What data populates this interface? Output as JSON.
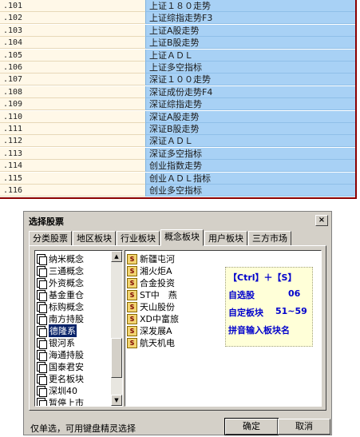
{
  "commands": [
    {
      "code": ".101",
      "desc": "上证１８０走势"
    },
    {
      "code": ".102",
      "desc": "上证综指走势F3"
    },
    {
      "code": ".103",
      "desc": "上证A股走势"
    },
    {
      "code": ".104",
      "desc": "上证B股走势"
    },
    {
      "code": ".105",
      "desc": "上证ＡＤＬ"
    },
    {
      "code": ".106",
      "desc": "上证多空指标"
    },
    {
      "code": ".107",
      "desc": "深证１００走势"
    },
    {
      "code": ".108",
      "desc": "深证成份走势F4"
    },
    {
      "code": ".109",
      "desc": "深证综指走势"
    },
    {
      "code": ".110",
      "desc": "深证A股走势"
    },
    {
      "code": ".111",
      "desc": "深证B股走势"
    },
    {
      "code": ".112",
      "desc": "深证ＡＤＬ"
    },
    {
      "code": ".113",
      "desc": "深证多空指标"
    },
    {
      "code": ".114",
      "desc": "创业指数走势"
    },
    {
      "code": ".115",
      "desc": "创业ＡＤＬ指标"
    },
    {
      "code": ".116",
      "desc": "创业多空指标"
    }
  ],
  "dialog": {
    "title": "选择股票",
    "close": "×",
    "tabs": [
      "分类股票",
      "地区板块",
      "行业板块",
      "概念板块",
      "用户板块",
      "三方市场"
    ],
    "active_tab": "概念板块",
    "concept_list": [
      "纳米概念",
      "三通概念",
      "外资概念",
      "基金重仓",
      "标购概念",
      "南方持股",
      "德隆系",
      "银河系",
      "海通持股",
      "国泰君安",
      "更名板块",
      "深圳40",
      "暂停上市"
    ],
    "selected_concept": "德隆系",
    "stocks": [
      "新疆屯河",
      "湘火炬A",
      "合金投资",
      "ST中　燕",
      "天山股份",
      "XD中富旅",
      "深发展A",
      "航天机电"
    ],
    "stock_icon": "S",
    "hint": {
      "line1": "【Ctrl】＋【S】",
      "line2_label": "自选股",
      "line2_value": "06",
      "line3_label": "自定板块",
      "line3_value": "51~59",
      "line4": "拼音输入板块名"
    },
    "status": "仅单选，可用键盘精灵选择",
    "ok": "确定",
    "cancel": "取消",
    "colors": {
      "table_code_bg": "#fff8e8",
      "table_desc_bg": "#a8d1f5",
      "border": "#8b0000",
      "hint_text": "#0000cc",
      "selection": "#0a246a"
    }
  }
}
